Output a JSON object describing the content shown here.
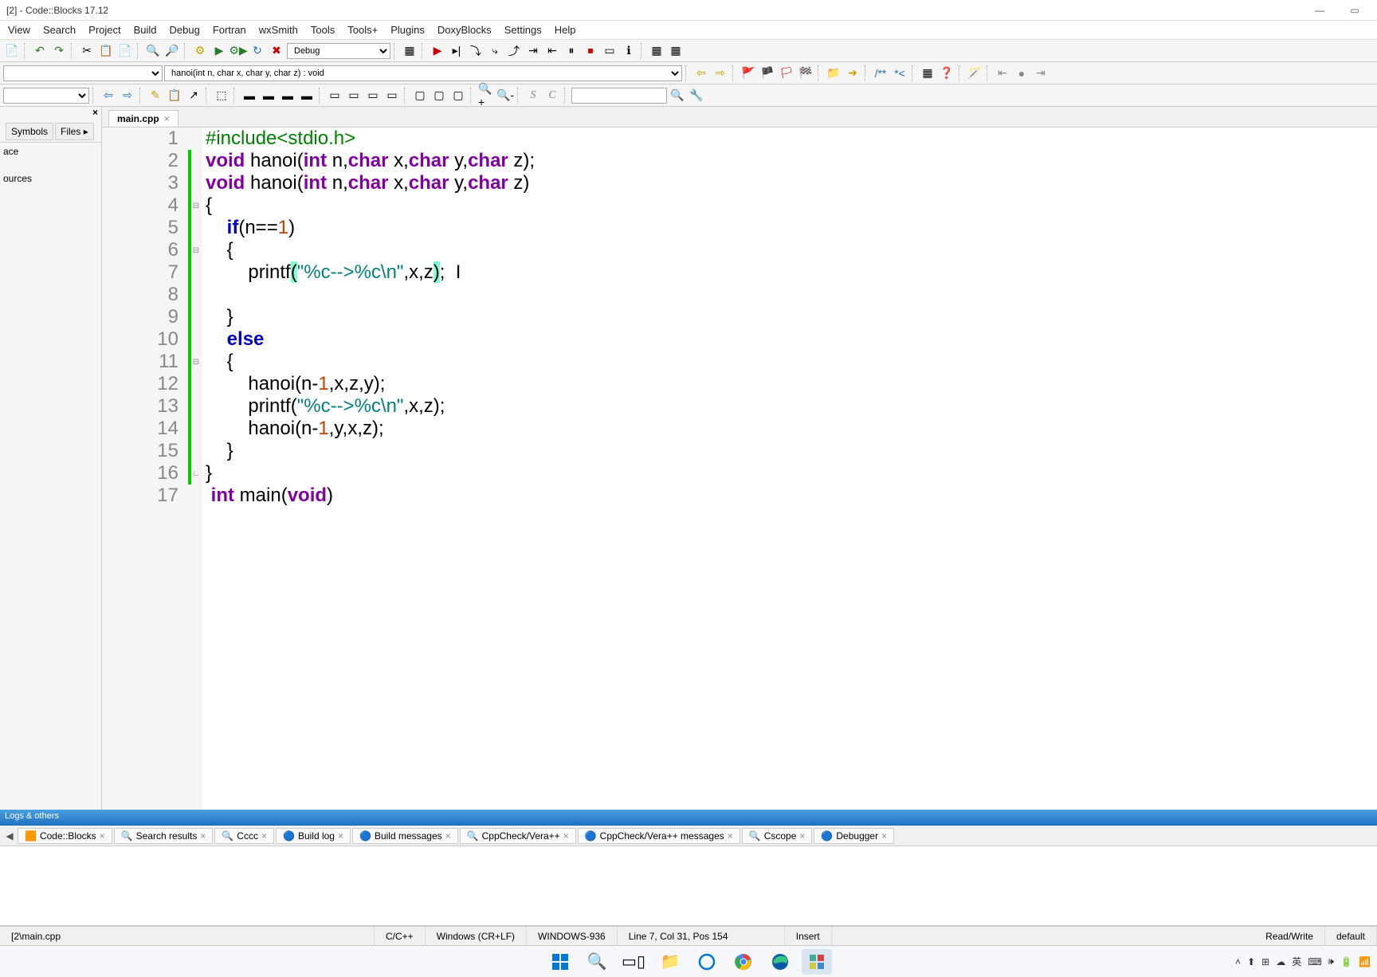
{
  "title": "[2] - Code::Blocks 17.12",
  "window_controls": {
    "min": "—",
    "max": "▭",
    "close": ""
  },
  "menus": [
    "View",
    "Search",
    "Project",
    "Build",
    "Debug",
    "Fortran",
    "wxSmith",
    "Tools",
    "Tools+",
    "Plugins",
    "DoxyBlocks",
    "Settings",
    "Help"
  ],
  "toolbar1": {
    "build_config": "Debug",
    "icons": [
      "new",
      "open",
      "save",
      "sep",
      "undo",
      "redo",
      "sep",
      "cut",
      "copy",
      "paste",
      "sep",
      "find",
      "replace",
      "sep",
      "build",
      "run",
      "build-run",
      "rebuild",
      "stop",
      "sep",
      "target",
      "sep",
      "dbg-start",
      "dbg-run",
      "dbg-pause",
      "dbg-step",
      "dbg-over",
      "dbg-out",
      "dbg-cursor",
      "dbg-break",
      "dbg-stop",
      "sep",
      "info1",
      "info2"
    ]
  },
  "toolbar2": {
    "scope_text": "hanoi(int n, char x, char y, char z) : void",
    "nav_icons": [
      "back",
      "forward",
      "sep",
      "bookmark",
      "bookmark-prev",
      "bookmark-next",
      "bookmark-clear",
      "sep",
      "folder",
      "jump",
      "sep",
      "doxy1",
      "doxy2",
      "sep",
      "todo",
      "sep",
      "format",
      "sep",
      "home",
      "dot",
      "arrow"
    ]
  },
  "toolbar3": {
    "icons": [
      "nav-back",
      "nav-fwd",
      "sep",
      "highlight",
      "mark",
      "jump",
      "sep",
      "select",
      "sep",
      "block1",
      "block2",
      "block3",
      "block4",
      "sep",
      "blockA",
      "blockB",
      "blockC",
      "blockD",
      "sep",
      "sq1",
      "sq2",
      "sq3",
      "sep",
      "zoom-in",
      "zoom-out",
      "sep",
      "S",
      "C",
      "sep",
      "search",
      "tool"
    ]
  },
  "side_panel": {
    "tabs": [
      "Symbols",
      "Files"
    ],
    "items": [
      "ace",
      "ources"
    ]
  },
  "editor_tab": {
    "name": "main.cpp"
  },
  "code": {
    "lines": [
      {
        "n": 1,
        "tokens": [
          {
            "t": "inc",
            "v": "#include<stdio.h>"
          }
        ]
      },
      {
        "n": 2,
        "tokens": [
          {
            "t": "typ",
            "v": "void"
          },
          {
            "t": "",
            "v": " hanoi("
          },
          {
            "t": "typ",
            "v": "int"
          },
          {
            "t": "",
            "v": " n,"
          },
          {
            "t": "typ",
            "v": "char"
          },
          {
            "t": "",
            "v": " x,"
          },
          {
            "t": "typ",
            "v": "char"
          },
          {
            "t": "",
            "v": " y,"
          },
          {
            "t": "typ",
            "v": "char"
          },
          {
            "t": "",
            "v": " z);"
          }
        ]
      },
      {
        "n": 3,
        "tokens": [
          {
            "t": "typ",
            "v": "void"
          },
          {
            "t": "",
            "v": " hanoi("
          },
          {
            "t": "typ",
            "v": "int"
          },
          {
            "t": "",
            "v": " n,"
          },
          {
            "t": "typ",
            "v": "char"
          },
          {
            "t": "",
            "v": " x,"
          },
          {
            "t": "typ",
            "v": "char"
          },
          {
            "t": "",
            "v": " y,"
          },
          {
            "t": "typ",
            "v": "char"
          },
          {
            "t": "",
            "v": " z)"
          }
        ]
      },
      {
        "n": 4,
        "tokens": [
          {
            "t": "",
            "v": "{"
          }
        ],
        "fold": "open"
      },
      {
        "n": 5,
        "tokens": [
          {
            "t": "",
            "v": "    "
          },
          {
            "t": "kw",
            "v": "if"
          },
          {
            "t": "",
            "v": "(n=="
          },
          {
            "t": "num",
            "v": "1"
          },
          {
            "t": "",
            "v": ")"
          }
        ]
      },
      {
        "n": 6,
        "tokens": [
          {
            "t": "",
            "v": "    {"
          }
        ],
        "fold": "open"
      },
      {
        "n": 7,
        "tokens": [
          {
            "t": "",
            "v": "        printf"
          },
          {
            "t": "hl",
            "v": "("
          },
          {
            "t": "str",
            "v": "\"%c-->%c\\n\""
          },
          {
            "t": "",
            "v": ",x,z"
          },
          {
            "t": "hl",
            "v": ")"
          },
          {
            "t": "",
            "v": ";  I"
          }
        ]
      },
      {
        "n": 8,
        "tokens": [
          {
            "t": "",
            "v": ""
          }
        ]
      },
      {
        "n": 9,
        "tokens": [
          {
            "t": "",
            "v": "    }"
          }
        ]
      },
      {
        "n": 10,
        "tokens": [
          {
            "t": "",
            "v": "    "
          },
          {
            "t": "kw",
            "v": "else"
          }
        ]
      },
      {
        "n": 11,
        "tokens": [
          {
            "t": "",
            "v": "    {"
          }
        ],
        "fold": "open"
      },
      {
        "n": 12,
        "tokens": [
          {
            "t": "",
            "v": "        hanoi(n-"
          },
          {
            "t": "num",
            "v": "1"
          },
          {
            "t": "",
            "v": ",x,z,y);"
          }
        ]
      },
      {
        "n": 13,
        "tokens": [
          {
            "t": "",
            "v": "        printf("
          },
          {
            "t": "str",
            "v": "\"%c-->%c\\n\""
          },
          {
            "t": "",
            "v": ",x,z);"
          }
        ]
      },
      {
        "n": 14,
        "tokens": [
          {
            "t": "",
            "v": "        hanoi(n-"
          },
          {
            "t": "num",
            "v": "1"
          },
          {
            "t": "",
            "v": ",y,x,z);"
          }
        ]
      },
      {
        "n": 15,
        "tokens": [
          {
            "t": "",
            "v": "    }"
          }
        ]
      },
      {
        "n": 16,
        "tokens": [
          {
            "t": "",
            "v": "}"
          }
        ],
        "fold": "close"
      },
      {
        "n": 17,
        "tokens": [
          {
            "t": "",
            "v": " "
          },
          {
            "t": "typ",
            "v": "int"
          },
          {
            "t": "",
            "v": " main("
          },
          {
            "t": "typ",
            "v": "void"
          },
          {
            "t": "",
            "v": ")"
          }
        ]
      }
    ]
  },
  "logs": {
    "header": "Logs & others",
    "tabs": [
      "Code::Blocks",
      "Search results",
      "Cccc",
      "Build log",
      "Build messages",
      "CppCheck/Vera++",
      "CppCheck/Vera++ messages",
      "Cscope",
      "Debugger"
    ]
  },
  "status": {
    "file": "[2\\main.cpp",
    "lang": "C/C++",
    "encoding_eol": "Windows (CR+LF)",
    "encoding": "WINDOWS-936",
    "cursor": "Line 7, Col 31, Pos 154",
    "insert": "Insert",
    "rw": "Read/Write",
    "profile": "default"
  },
  "taskbar": {
    "apps": [
      "start",
      "search",
      "tasks",
      "files",
      "edge-legacy",
      "chrome",
      "edge",
      "codeblocks"
    ],
    "tray": [
      "^",
      "⬆",
      "⊞",
      "OneDrive",
      "英",
      "⌨",
      "🕪",
      "🔋",
      "📶"
    ]
  }
}
